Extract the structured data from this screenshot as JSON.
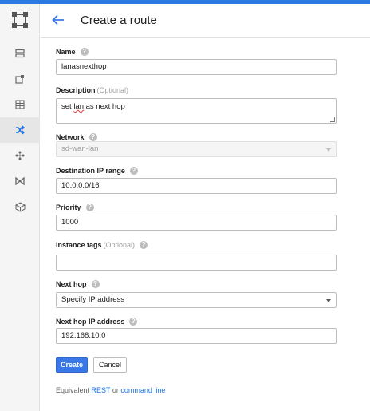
{
  "header": {
    "title": "Create a route"
  },
  "sidebar": {
    "items": [
      {
        "icon": "storage-icon"
      },
      {
        "icon": "external-link-icon"
      },
      {
        "icon": "grid-icon"
      },
      {
        "icon": "shuffle-routes-icon",
        "active": true
      },
      {
        "icon": "network-nodes-icon"
      },
      {
        "icon": "bowtie-icon"
      },
      {
        "icon": "cube-icon"
      }
    ]
  },
  "form": {
    "name": {
      "label": "Name",
      "value": "lanasnexthop"
    },
    "description": {
      "label": "Description",
      "optional": "(Optional)",
      "value_before": "set ",
      "value_misspelled": "lan",
      "value_after": " as next hop"
    },
    "network": {
      "label": "Network",
      "value": "sd-wan-lan"
    },
    "destination": {
      "label": "Destination IP range",
      "value": "10.0.0.0/16"
    },
    "priority": {
      "label": "Priority",
      "value": "1000"
    },
    "instance_tags": {
      "label": "Instance tags",
      "optional": "(Optional)",
      "value": ""
    },
    "next_hop": {
      "label": "Next hop",
      "value": "Specify IP address"
    },
    "next_hop_ip": {
      "label": "Next hop IP address",
      "value": "192.168.10.0"
    }
  },
  "buttons": {
    "create": "Create",
    "cancel": "Cancel"
  },
  "footer": {
    "prefix": "Equivalent ",
    "rest": "REST",
    "or": " or ",
    "command_line": "command line"
  },
  "colors": {
    "accent": "#3b78e7",
    "topbar": "#2a7ae2",
    "link": "#1a73e8"
  }
}
